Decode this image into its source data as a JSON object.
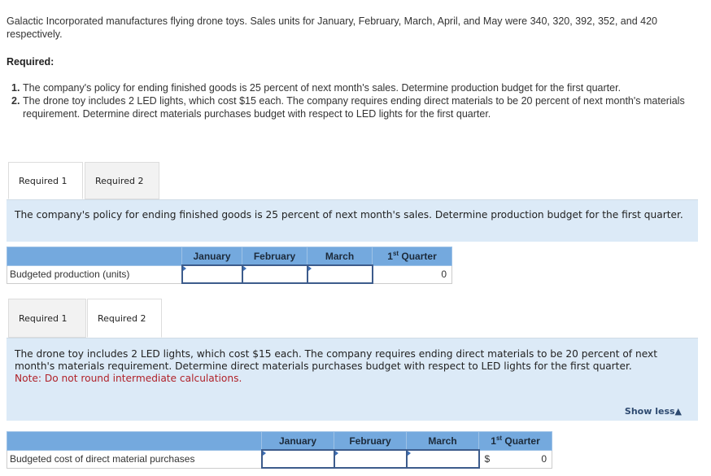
{
  "intro": "Galactic Incorporated manufactures flying drone toys. Sales units for January, February, March, April, and May were 340, 320, 392, 352, and 420 respectively.",
  "required_label": "Required:",
  "requirements": [
    {
      "num": "1.",
      "text": "The company's policy for ending finished goods is 25 percent of next month's sales. Determine production budget for the first quarter."
    },
    {
      "num": "2.",
      "text": "The drone toy includes 2 LED lights, which cost $15 each. The company requires ending direct materials to be 20 percent of next month's materials requirement. Determine direct materials purchases budget with respect to LED lights for the first quarter."
    }
  ],
  "section1": {
    "tabs": [
      {
        "label": "Required 1",
        "active": true
      },
      {
        "label": "Required 2",
        "active": false
      }
    ],
    "instruction": "The company's policy for ending finished goods is 25 percent of next month's sales. Determine production budget for the first quarter.",
    "table": {
      "headers": [
        "",
        "January",
        "February",
        "March",
        "1st Quarter"
      ],
      "header_quarter_num": "1",
      "header_quarter_sup": "st",
      "header_quarter_word": " Quarter",
      "row": {
        "label": "Budgeted production (units)",
        "january": "",
        "february": "",
        "march": "",
        "quarter": "0"
      }
    }
  },
  "section2": {
    "tabs": [
      {
        "label": "Required 1",
        "active": false
      },
      {
        "label": "Required 2",
        "active": true
      }
    ],
    "instruction": "The drone toy includes 2 LED lights, which cost $15 each. The company requires ending direct materials to be 20 percent of next month's materials requirement. Determine direct materials purchases budget with respect to LED lights for the first quarter.",
    "note": "Note: Do not round intermediate calculations.",
    "show_less": "Show less▲",
    "table": {
      "headers": [
        "",
        "January",
        "February",
        "March",
        "1st Quarter"
      ],
      "header_quarter_num": "1",
      "header_quarter_sup": "st",
      "header_quarter_word": " Quarter",
      "row": {
        "label": "Budgeted cost of direct material purchases",
        "january": "",
        "february": "",
        "march": "",
        "currency": "$",
        "quarter": "0"
      }
    }
  },
  "colors": {
    "panel_bg": "#dceaf7",
    "table_header": "#74a9de",
    "note": "#b0222a",
    "input_border": "#3d5c8c"
  }
}
